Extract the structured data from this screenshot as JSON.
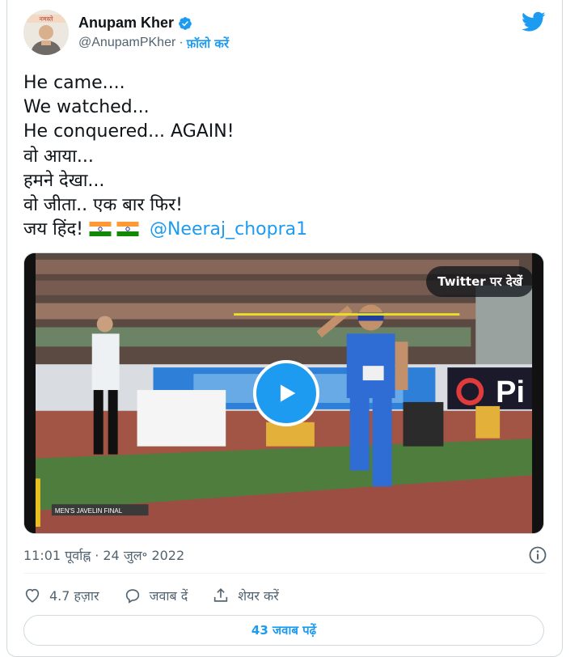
{
  "author": {
    "name": "Anupam Kher",
    "handle": "@AnupamPKher",
    "separator": "·",
    "follow_label": "फ़ॉलो करें",
    "verified": true
  },
  "tweet": {
    "lines": [
      "He came....",
      "We watched...",
      "He conquered... AGAIN!",
      "वो आया...",
      "हमने देखा...",
      "वो जीता.. एक बार फिर!"
    ],
    "last_line_prefix": "जय हिंद!",
    "mention": "@Neeraj_chopra1",
    "flags": [
      "india-flag",
      "india-flag"
    ]
  },
  "media": {
    "watch_label": "Twitter पर देखें",
    "overlay_caption": "MEN'S JAVELIN FINAL",
    "banner_text": "Pi"
  },
  "meta": {
    "time": "11:01 पूर्वाह्न",
    "separator": "·",
    "date": "24 जुल॰ 2022"
  },
  "actions": {
    "like_count": "4.7 हज़ार",
    "reply_label": "जवाब दें",
    "share_label": "शेयर करें"
  },
  "replies_button": "43 जवाब पढ़ें",
  "colors": {
    "accent": "#1d9bf0",
    "text": "#0f1419",
    "muted": "#536471",
    "border": "#cfd9de"
  },
  "icons": [
    "verified-badge-icon",
    "twitter-bird-icon",
    "play-icon",
    "info-icon",
    "heart-icon",
    "reply-icon",
    "share-icon"
  ]
}
